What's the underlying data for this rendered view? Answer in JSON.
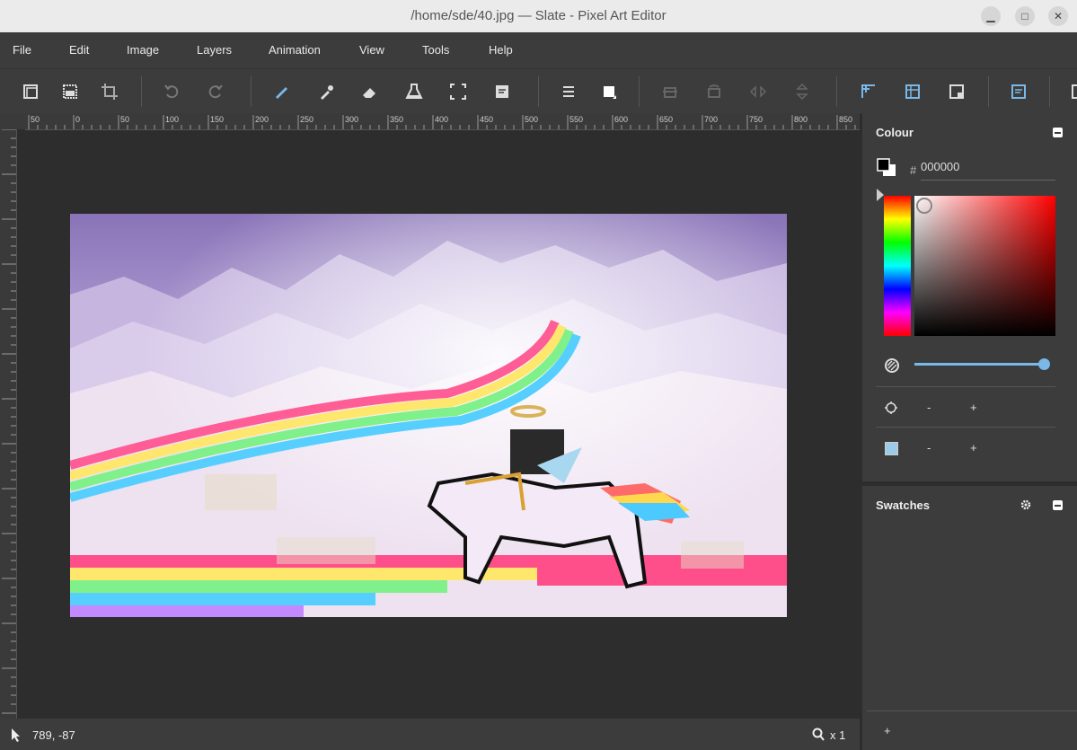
{
  "window": {
    "title": "/home/sde/40.jpg — Slate - Pixel Art Editor"
  },
  "menu": [
    "File",
    "Edit",
    "Image",
    "Layers",
    "Animation",
    "View",
    "Tools",
    "Help"
  ],
  "toolbar": {
    "tools": [
      "layers-icon",
      "select-all-icon",
      "crop-icon",
      "undo-icon",
      "redo-icon",
      "pen-icon",
      "eyedropper-icon",
      "eraser-icon",
      "fill-icon",
      "selection-icon",
      "notes-icon",
      "menu-icon",
      "fill-rect-icon",
      "flip-h-icon",
      "flip-v-icon",
      "rotate-h-icon",
      "rotate-v-icon",
      "grid-icon",
      "tile-icon",
      "panel-icon",
      "note-icon"
    ]
  },
  "ruler": {
    "h_ticks": [
      "50",
      "0",
      "50",
      "100",
      "150",
      "200",
      "250",
      "300",
      "350",
      "400",
      "450",
      "500",
      "550",
      "600",
      "650",
      "700",
      "750",
      "800",
      "850"
    ]
  },
  "status": {
    "coords": "789, -87",
    "zoom": "x 1"
  },
  "colour_panel": {
    "title": "Colour",
    "hex_prefix": "#",
    "hex_value": "000000",
    "opacity": 1.0,
    "brush_minus": "-",
    "brush_plus": "+",
    "brush2_minus": "-",
    "brush2_plus": "+"
  },
  "swatches_panel": {
    "title": "Swatches",
    "add": "+"
  },
  "colors": {
    "accent": "#7ab8e8",
    "panel": "#3c3c3c",
    "bg": "#2d2d2d"
  }
}
